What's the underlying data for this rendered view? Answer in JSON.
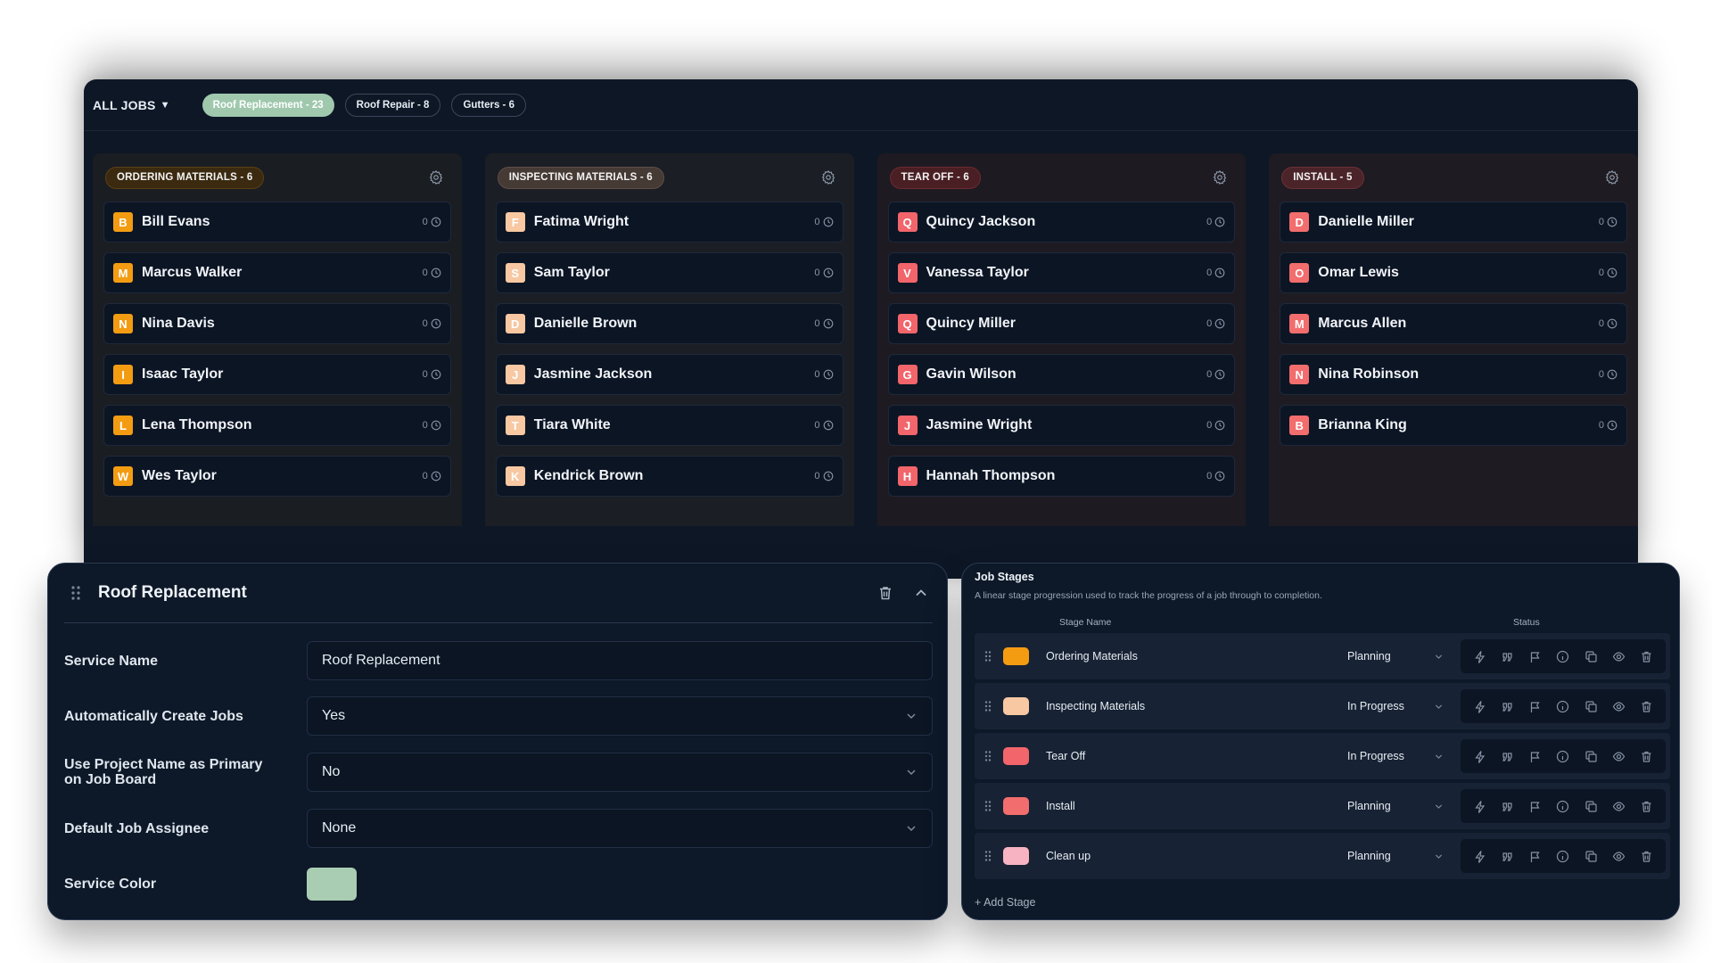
{
  "board": {
    "all_jobs_label": "ALL JOBS",
    "filters": [
      {
        "label": "Roof Replacement - 23",
        "active": true
      },
      {
        "label": "Roof Repair - 8",
        "active": false
      },
      {
        "label": "Gutters - 6",
        "active": false
      }
    ],
    "columns": [
      {
        "label": "ORDERING MATERIALS - 6",
        "pill_color": "#3b2a10",
        "pill_border": "#5a4016",
        "bg": "#1a1d22",
        "avatar_color": "#f39c12",
        "cards": [
          {
            "initial": "B",
            "name": "Bill Evans",
            "count": "0"
          },
          {
            "initial": "M",
            "name": "Marcus Walker",
            "count": "0"
          },
          {
            "initial": "N",
            "name": "Nina Davis",
            "count": "0"
          },
          {
            "initial": "I",
            "name": "Isaac Taylor",
            "count": "0"
          },
          {
            "initial": "L",
            "name": "Lena Thompson",
            "count": "0"
          },
          {
            "initial": "W",
            "name": "Wes Taylor",
            "count": "0"
          }
        ]
      },
      {
        "label": "INSPECTING MATERIALS - 6",
        "pill_color": "#463a35",
        "pill_border": "#5e4e47",
        "bg": "#1b1e24",
        "avatar_color": "#f7c8a2",
        "cards": [
          {
            "initial": "F",
            "name": "Fatima Wright",
            "count": "0"
          },
          {
            "initial": "S",
            "name": "Sam Taylor",
            "count": "0"
          },
          {
            "initial": "D",
            "name": "Danielle Brown",
            "count": "0"
          },
          {
            "initial": "J",
            "name": "Jasmine Jackson",
            "count": "0"
          },
          {
            "initial": "T",
            "name": "Tiara White",
            "count": "0"
          },
          {
            "initial": "K",
            "name": "Kendrick Brown",
            "count": "0"
          }
        ]
      },
      {
        "label": "TEAR OFF - 6",
        "pill_color": "#4a1f24",
        "pill_border": "#6a2a31",
        "bg": "#1e1a22",
        "avatar_color": "#f2656b",
        "cards": [
          {
            "initial": "Q",
            "name": "Quincy Jackson",
            "count": "0"
          },
          {
            "initial": "V",
            "name": "Vanessa Taylor",
            "count": "0"
          },
          {
            "initial": "Q",
            "name": "Quincy Miller",
            "count": "0"
          },
          {
            "initial": "G",
            "name": "Gavin Wilson",
            "count": "0"
          },
          {
            "initial": "J",
            "name": "Jasmine Wright",
            "count": "0"
          },
          {
            "initial": "H",
            "name": "Hannah Thompson",
            "count": "0"
          }
        ]
      },
      {
        "label": "INSTALL - 5",
        "pill_color": "#4b2429",
        "pill_border": "#6b3038",
        "bg": "#1e1b22",
        "avatar_color": "#f26d6d",
        "cards": [
          {
            "initial": "D",
            "name": "Danielle Miller",
            "count": "0"
          },
          {
            "initial": "O",
            "name": "Omar Lewis",
            "count": "0"
          },
          {
            "initial": "M",
            "name": "Marcus Allen",
            "count": "0"
          },
          {
            "initial": "N",
            "name": "Nina Robinson",
            "count": "0"
          },
          {
            "initial": "B",
            "name": "Brianna King",
            "count": "0"
          }
        ]
      }
    ]
  },
  "service": {
    "title": "Roof Replacement",
    "fields": {
      "service_name_label": "Service Name",
      "service_name_value": "Roof Replacement",
      "auto_create_label": "Automatically Create Jobs",
      "auto_create_value": "Yes",
      "project_name_label": "Use Project Name as Primary on Job Board",
      "project_name_value": "No",
      "assignee_label": "Default Job Assignee",
      "assignee_value": "None",
      "color_label": "Service Color",
      "color_value": "#a8cdb2"
    }
  },
  "stages": {
    "title": "Job Stages",
    "description": "A linear stage progression used to track the progress of a job through to completion.",
    "col_stage_name": "Stage Name",
    "col_status": "Status",
    "rows": [
      {
        "name": "Ordering Materials",
        "status": "Planning",
        "color": "#f39c12"
      },
      {
        "name": "Inspecting Materials",
        "status": "In Progress",
        "color": "#f7c8a2"
      },
      {
        "name": "Tear Off",
        "status": "In Progress",
        "color": "#f2656b"
      },
      {
        "name": "Install",
        "status": "Planning",
        "color": "#f26d6d"
      },
      {
        "name": "Clean up",
        "status": "Planning",
        "color": "#f7b3c2"
      }
    ],
    "add_label": "+ Add Stage"
  }
}
